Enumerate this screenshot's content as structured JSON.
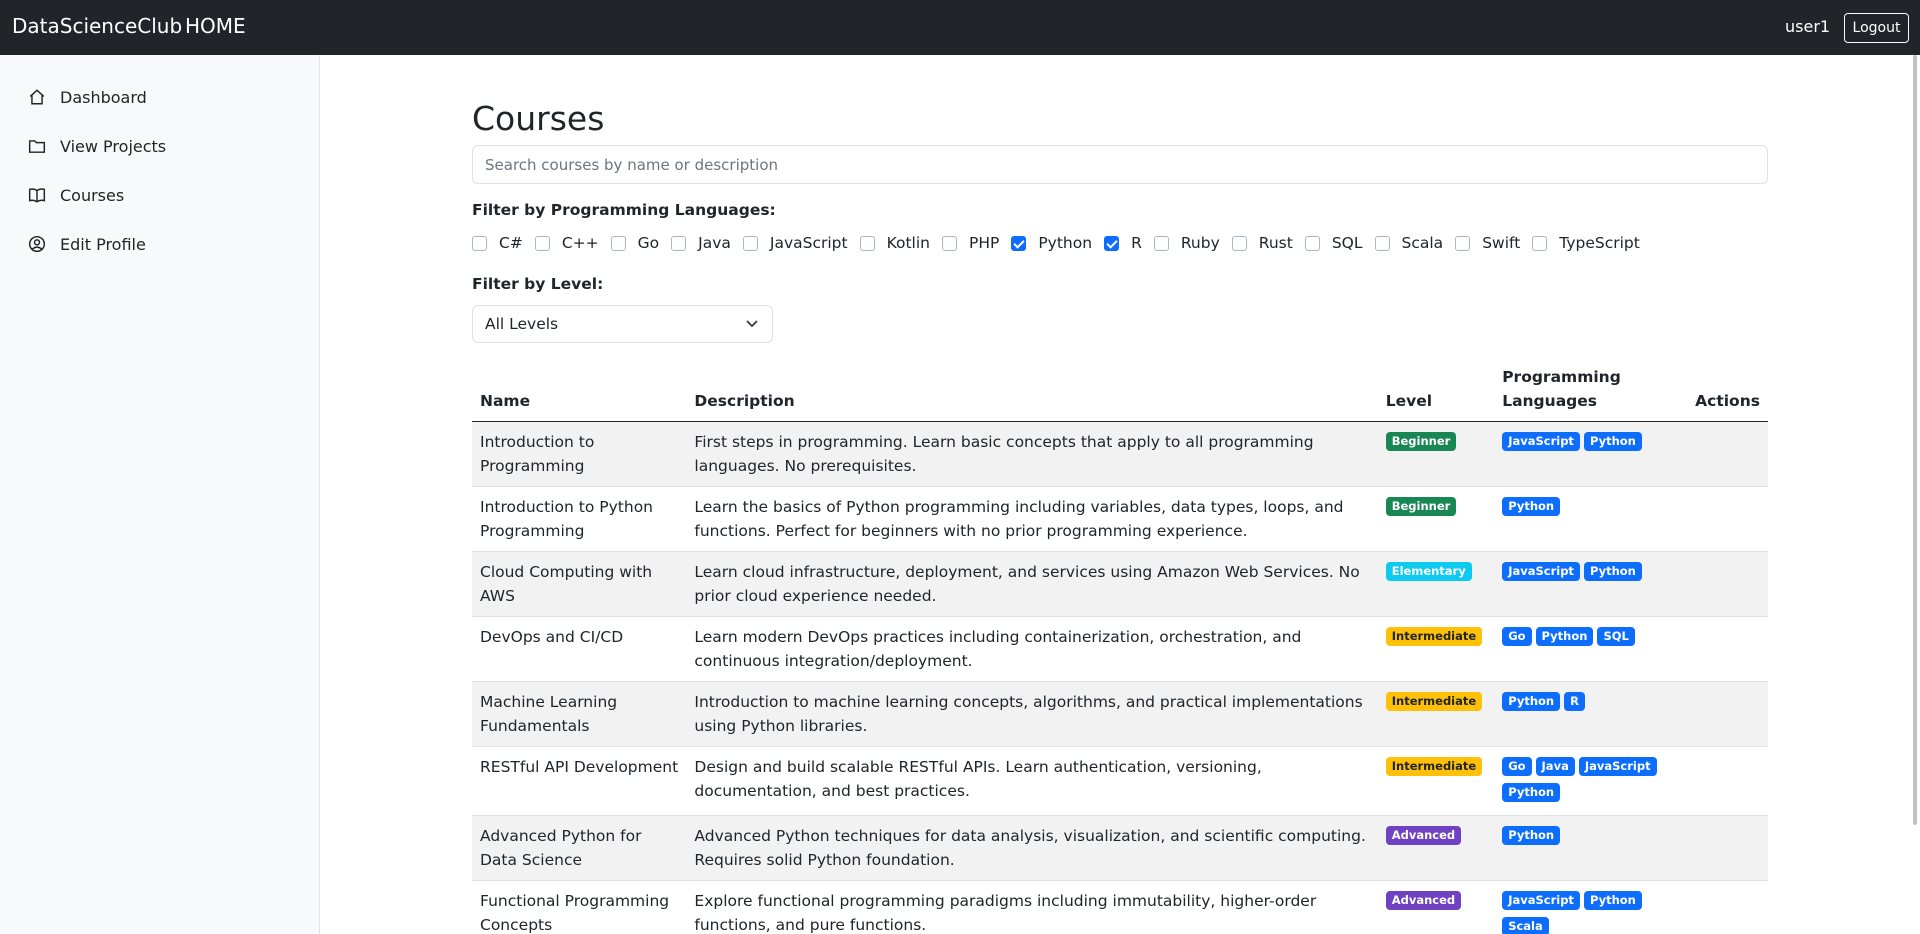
{
  "navbar": {
    "brand": "DataScienceClub",
    "home": "HOME",
    "user": "user1",
    "logout": "Logout"
  },
  "sidebar": {
    "items": [
      {
        "label": "Dashboard",
        "icon": "house-icon"
      },
      {
        "label": "View Projects",
        "icon": "folder-icon"
      },
      {
        "label": "Courses",
        "icon": "book-icon"
      },
      {
        "label": "Edit Profile",
        "icon": "person-circle-icon"
      }
    ]
  },
  "main": {
    "title": "Courses",
    "search_placeholder": "Search courses by name or description",
    "lang_filter_title": "Filter by Programming Languages:",
    "languages": [
      {
        "label": "C#",
        "checked": false
      },
      {
        "label": "C++",
        "checked": false
      },
      {
        "label": "Go",
        "checked": false
      },
      {
        "label": "Java",
        "checked": false
      },
      {
        "label": "JavaScript",
        "checked": false
      },
      {
        "label": "Kotlin",
        "checked": false
      },
      {
        "label": "PHP",
        "checked": false
      },
      {
        "label": "Python",
        "checked": true
      },
      {
        "label": "R",
        "checked": true
      },
      {
        "label": "Ruby",
        "checked": false
      },
      {
        "label": "Rust",
        "checked": false
      },
      {
        "label": "SQL",
        "checked": false
      },
      {
        "label": "Scala",
        "checked": false
      },
      {
        "label": "Swift",
        "checked": false
      },
      {
        "label": "TypeScript",
        "checked": false
      }
    ],
    "level_filter_title": "Filter by Level:",
    "level_selected": "All Levels"
  },
  "table": {
    "headers": {
      "name": "Name",
      "description": "Description",
      "level": "Level",
      "languages_line1": "Programming",
      "languages_line2": "Languages",
      "actions": "Actions"
    },
    "rows": [
      {
        "name": "Introduction to Programming",
        "description": "First steps in programming. Learn basic concepts that apply to all programming languages. No prerequisites.",
        "level": "Beginner",
        "languages": [
          "JavaScript",
          "Python"
        ]
      },
      {
        "name": "Introduction to Python Programming",
        "description": "Learn the basics of Python programming including variables, data types, loops, and functions. Perfect for beginners with no prior programming experience.",
        "level": "Beginner",
        "languages": [
          "Python"
        ]
      },
      {
        "name": "Cloud Computing with AWS",
        "description": "Learn cloud infrastructure, deployment, and services using Amazon Web Services. No prior cloud experience needed.",
        "level": "Elementary",
        "languages": [
          "JavaScript",
          "Python"
        ]
      },
      {
        "name": "DevOps and CI/CD",
        "description": "Learn modern DevOps practices including containerization, orchestration, and continuous integration/deployment.",
        "level": "Intermediate",
        "languages": [
          "Go",
          "Python",
          "SQL"
        ]
      },
      {
        "name": "Machine Learning Fundamentals",
        "description": "Introduction to machine learning concepts, algorithms, and practical implementations using Python libraries.",
        "level": "Intermediate",
        "languages": [
          "Python",
          "R"
        ]
      },
      {
        "name": "RESTful API Development",
        "description": "Design and build scalable RESTful APIs. Learn authentication, versioning, documentation, and best practices.",
        "level": "Intermediate",
        "languages": [
          "Go",
          "Java",
          "JavaScript",
          "Python"
        ]
      },
      {
        "name": "Advanced Python for Data Science",
        "description": "Advanced Python techniques for data analysis, visualization, and scientific computing. Requires solid Python foundation.",
        "level": "Advanced",
        "languages": [
          "Python"
        ]
      },
      {
        "name": "Functional Programming Concepts",
        "description": "Explore functional programming paradigms including immutability, higher-order functions, and pure functions.",
        "level": "Advanced",
        "languages": [
          "JavaScript",
          "Python",
          "Scala"
        ]
      }
    ]
  },
  "colors": {
    "navbar": "#212529",
    "primary": "#0d6efd",
    "beginner": "#198754",
    "elementary": "#0dcaf0",
    "intermediate": "#ffc107",
    "advanced": "#6f42c1"
  }
}
